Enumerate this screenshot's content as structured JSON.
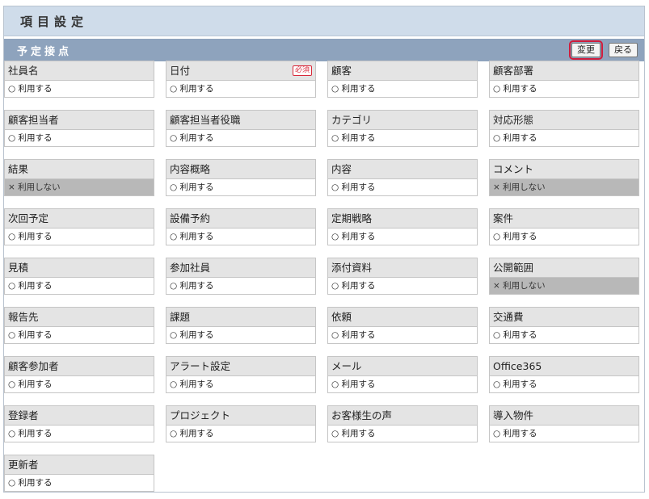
{
  "header": {
    "title": "項目設定"
  },
  "section": {
    "title": "予定接点",
    "change_label": "変更",
    "back_label": "戻る"
  },
  "labels": {
    "required": "必須"
  },
  "items": [
    {
      "name": "社員名",
      "status": "○ 利用する",
      "enabled": true,
      "required": false
    },
    {
      "name": "日付",
      "status": "○ 利用する",
      "enabled": true,
      "required": true
    },
    {
      "name": "顧客",
      "status": "○ 利用する",
      "enabled": true,
      "required": false
    },
    {
      "name": "顧客部署",
      "status": "○ 利用する",
      "enabled": true,
      "required": false
    },
    {
      "name": "顧客担当者",
      "status": "○ 利用する",
      "enabled": true,
      "required": false
    },
    {
      "name": "顧客担当者役職",
      "status": "○ 利用する",
      "enabled": true,
      "required": false
    },
    {
      "name": "カテゴリ",
      "status": "○ 利用する",
      "enabled": true,
      "required": false
    },
    {
      "name": "対応形態",
      "status": "○ 利用する",
      "enabled": true,
      "required": false
    },
    {
      "name": "結果",
      "status": "× 利用しない",
      "enabled": false,
      "required": false
    },
    {
      "name": "内容概略",
      "status": "○ 利用する",
      "enabled": true,
      "required": false
    },
    {
      "name": "内容",
      "status": "○ 利用する",
      "enabled": true,
      "required": false
    },
    {
      "name": "コメント",
      "status": "× 利用しない",
      "enabled": false,
      "required": false
    },
    {
      "name": "次回予定",
      "status": "○ 利用する",
      "enabled": true,
      "required": false
    },
    {
      "name": "設備予約",
      "status": "○ 利用する",
      "enabled": true,
      "required": false
    },
    {
      "name": "定期戦略",
      "status": "○ 利用する",
      "enabled": true,
      "required": false
    },
    {
      "name": "案件",
      "status": "○ 利用する",
      "enabled": true,
      "required": false
    },
    {
      "name": "見積",
      "status": "○ 利用する",
      "enabled": true,
      "required": false
    },
    {
      "name": "参加社員",
      "status": "○ 利用する",
      "enabled": true,
      "required": false
    },
    {
      "name": "添付資料",
      "status": "○ 利用する",
      "enabled": true,
      "required": false
    },
    {
      "name": "公開範囲",
      "status": "× 利用しない",
      "enabled": false,
      "required": false
    },
    {
      "name": "報告先",
      "status": "○ 利用する",
      "enabled": true,
      "required": false
    },
    {
      "name": "課題",
      "status": "○ 利用する",
      "enabled": true,
      "required": false
    },
    {
      "name": "依頼",
      "status": "○ 利用する",
      "enabled": true,
      "required": false
    },
    {
      "name": "交通費",
      "status": "○ 利用する",
      "enabled": true,
      "required": false
    },
    {
      "name": "顧客参加者",
      "status": "○ 利用する",
      "enabled": true,
      "required": false
    },
    {
      "name": "アラート設定",
      "status": "○ 利用する",
      "enabled": true,
      "required": false
    },
    {
      "name": "メール",
      "status": "○ 利用する",
      "enabled": true,
      "required": false
    },
    {
      "name": "Office365",
      "status": "○ 利用する",
      "enabled": true,
      "required": false
    },
    {
      "name": "登録者",
      "status": "○ 利用する",
      "enabled": true,
      "required": false
    },
    {
      "name": "プロジェクト",
      "status": "○ 利用する",
      "enabled": true,
      "required": false
    },
    {
      "name": "お客様生の声",
      "status": "○ 利用する",
      "enabled": true,
      "required": false
    },
    {
      "name": "導入物件",
      "status": "○ 利用する",
      "enabled": true,
      "required": false
    },
    {
      "name": "更新者",
      "status": "○ 利用する",
      "enabled": true,
      "required": false
    }
  ]
}
